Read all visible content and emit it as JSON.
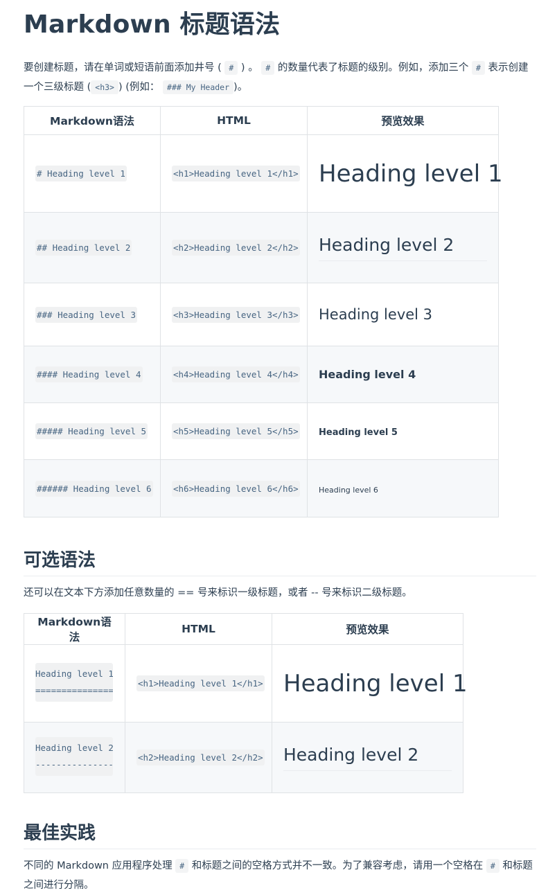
{
  "title": "Markdown 标题语法",
  "intro": {
    "part1": "要创建标题，请在单词或短语前面添加井号 (",
    "code1": "#",
    "part2": ") 。",
    "code2": "#",
    "part3": "的数量代表了标题的级别。例如，添加三个",
    "code3": "#",
    "part4": "表示创建一个三级标题 (",
    "code4": "<h3>",
    "part5": ") (例如：",
    "code5": "### My Header",
    "part6": ")。"
  },
  "table1": {
    "headers": [
      "Markdown语法",
      "HTML",
      "预览效果"
    ],
    "rows": [
      {
        "md": "# Heading level 1",
        "html": "<h1>Heading level 1</h1>",
        "preview": "Heading level 1"
      },
      {
        "md": "## Heading level 2",
        "html": "<h2>Heading level 2</h2>",
        "preview": "Heading level 2"
      },
      {
        "md": "### Heading level 3",
        "html": "<h3>Heading level 3</h3>",
        "preview": "Heading level 3"
      },
      {
        "md": "#### Heading level 4",
        "html": "<h4>Heading level 4</h4>",
        "preview": "Heading level 4"
      },
      {
        "md": "##### Heading level 5",
        "html": "<h5>Heading level 5</h5>",
        "preview": "Heading level 5"
      },
      {
        "md": "###### Heading level 6",
        "html": "<h6>Heading level 6</h6>",
        "preview": "Heading level 6"
      }
    ]
  },
  "alt_section": {
    "heading": "可选语法",
    "text": "还可以在文本下方添加任意数量的 == 号来标识一级标题，或者 -- 号来标识二级标题。"
  },
  "table2": {
    "headers": [
      "Markdown语法",
      "HTML",
      "预览效果"
    ],
    "rows": [
      {
        "md": "Heading level 1\n===============",
        "html": "<h1>Heading level 1</h1>",
        "preview": "Heading level 1"
      },
      {
        "md": "Heading level 2\n---------------",
        "html": "<h2>Heading level 2</h2>",
        "preview": "Heading level 2"
      }
    ]
  },
  "best_section": {
    "heading": "最佳实践",
    "part1": "不同的 Markdown 应用程序处理",
    "code1": "#",
    "part2": "和标题之间的空格方式并不一致。为了兼容考虑，请用一个空格在",
    "code2": "#",
    "part3": "和标题之间进行分隔。"
  }
}
